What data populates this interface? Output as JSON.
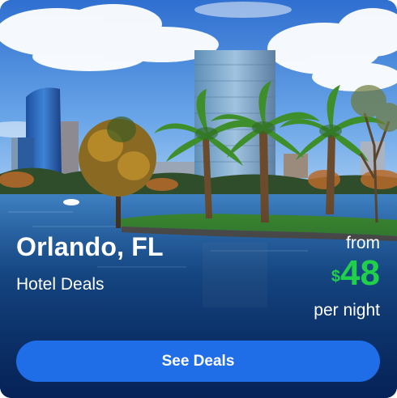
{
  "destination": {
    "city": "Orlando, FL",
    "subtitle": "Hotel Deals"
  },
  "price": {
    "from_label": "from",
    "currency_symbol": "$",
    "amount": "48",
    "unit_label": "per night"
  },
  "cta": {
    "label": "See Deals"
  },
  "colors": {
    "price_green": "#21d04a",
    "button_blue": "#1f6ee8"
  }
}
